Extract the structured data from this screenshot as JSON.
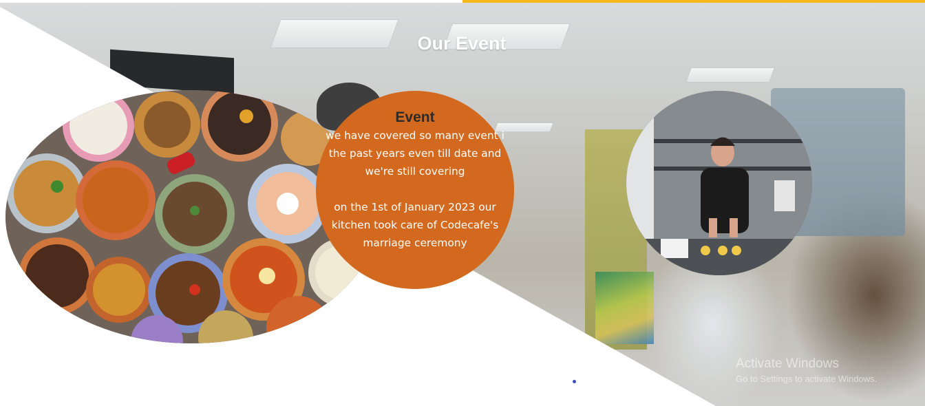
{
  "section": {
    "title": "Our Event"
  },
  "event_card": {
    "heading": "Event",
    "paragraph_1": "we have covered so many event i the past years even till date and we're still covering",
    "paragraph_2": "on the 1st of January 2023 our kitchen took care of Codecafe's marriage ceremony"
  },
  "images": {
    "food": "food-bowls-photo",
    "chef": "chef-cooking-photo",
    "background": "office-team-photo"
  },
  "os_watermark": {
    "title": "Activate Windows",
    "subtitle": "Go to Settings to activate Windows."
  },
  "colors": {
    "accent_orange": "#d2691e",
    "top_accent_yellow": "#f5b71a",
    "heading_dark": "#2b2b2b"
  }
}
